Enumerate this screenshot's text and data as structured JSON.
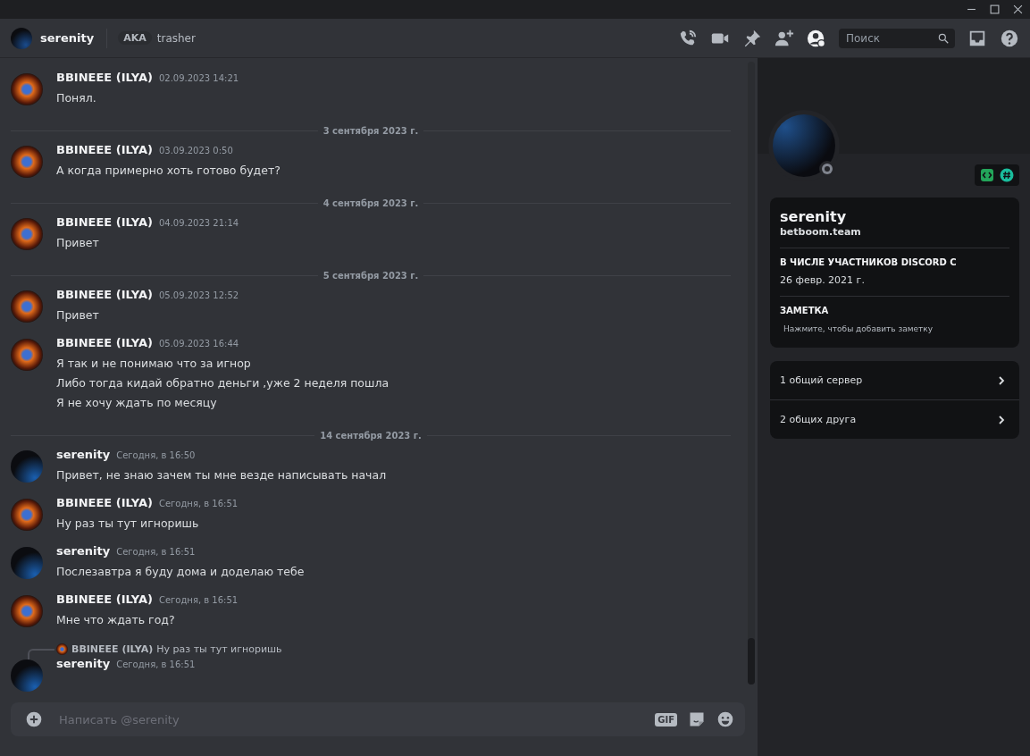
{
  "header": {
    "name": "serenity",
    "aka_badge": "AKA",
    "aka_name": "trasher",
    "search": {
      "placeholder": "Поиск"
    }
  },
  "messages": [
    {
      "kind": "message",
      "avatar": {
        "kind": "fire"
      },
      "author": "BBINEEE (ILYA)",
      "time": "02.09.2023 14:21",
      "lines": [
        "Понял."
      ]
    },
    {
      "kind": "divider",
      "text": "3 сентября 2023 г."
    },
    {
      "kind": "message",
      "avatar": {
        "kind": "fire"
      },
      "author": "BBINEEE (ILYA)",
      "time": "03.09.2023 0:50",
      "lines": [
        "А когда примерно хоть готово будет?"
      ]
    },
    {
      "kind": "divider",
      "text": "4 сентября 2023 г."
    },
    {
      "kind": "message",
      "avatar": {
        "kind": "fire"
      },
      "author": "BBINEEE (ILYA)",
      "time": "04.09.2023 21:14",
      "lines": [
        "Привет"
      ]
    },
    {
      "kind": "divider",
      "text": "5 сентября 2023 г."
    },
    {
      "kind": "message",
      "avatar": {
        "kind": "fire"
      },
      "author": "BBINEEE (ILYA)",
      "time": "05.09.2023 12:52",
      "lines": [
        "Привет"
      ]
    },
    {
      "kind": "message",
      "avatar": {
        "kind": "fire"
      },
      "author": "BBINEEE (ILYA)",
      "time": "05.09.2023 16:44",
      "lines": [
        "Я так и не понимаю что за игнор",
        "Либо тогда кидай обратно деньги ,уже 2 неделя пошла",
        "Я не хочу ждать по месяцу"
      ]
    },
    {
      "kind": "divider",
      "text": "14 сентября 2023 г."
    },
    {
      "kind": "message",
      "avatar": {
        "kind": "blue"
      },
      "author": "serenity",
      "time": "Сегодня, в 16:50",
      "lines": [
        "Привет, не знаю зачем ты мне везде написывать начал"
      ]
    },
    {
      "kind": "message",
      "avatar": {
        "kind": "fire"
      },
      "author": "BBINEEE (ILYA)",
      "time": "Сегодня, в 16:51",
      "lines": [
        "Ну раз ты тут игноришь"
      ]
    },
    {
      "kind": "message",
      "avatar": {
        "kind": "blue"
      },
      "author": "serenity",
      "time": "Сегодня, в 16:51",
      "lines": [
        "Послезавтра я буду дома и доделаю тебе"
      ]
    },
    {
      "kind": "message",
      "avatar": {
        "kind": "fire"
      },
      "author": "BBINEEE (ILYA)",
      "time": "Сегодня, в 16:51",
      "lines": [
        "Мне что ждать год?"
      ]
    },
    {
      "kind": "message",
      "avatar": {
        "kind": "blue"
      },
      "author": "serenity",
      "time": "Сегодня, в 16:51",
      "reply": {
        "avatar": {
          "kind": "fire"
        },
        "author": "BBINEEE (ILYA)",
        "text": "Ну раз ты тут игноришь"
      }
    }
  ],
  "composer": {
    "placeholder": "Написать @serenity",
    "gif": "GIF"
  },
  "profile": {
    "name": "serenity",
    "username": "betboom.team",
    "member_since_label": "В ЧИСЛЕ УЧАСТНИКОВ DISCORD С",
    "member_since": "26 февр. 2021 г.",
    "note_label": "ЗАМЕТКА",
    "note_placeholder": "Нажмите, чтобы добавить заметку"
  },
  "mutuals": [
    "1 общий сервер",
    "2 общих друга"
  ]
}
